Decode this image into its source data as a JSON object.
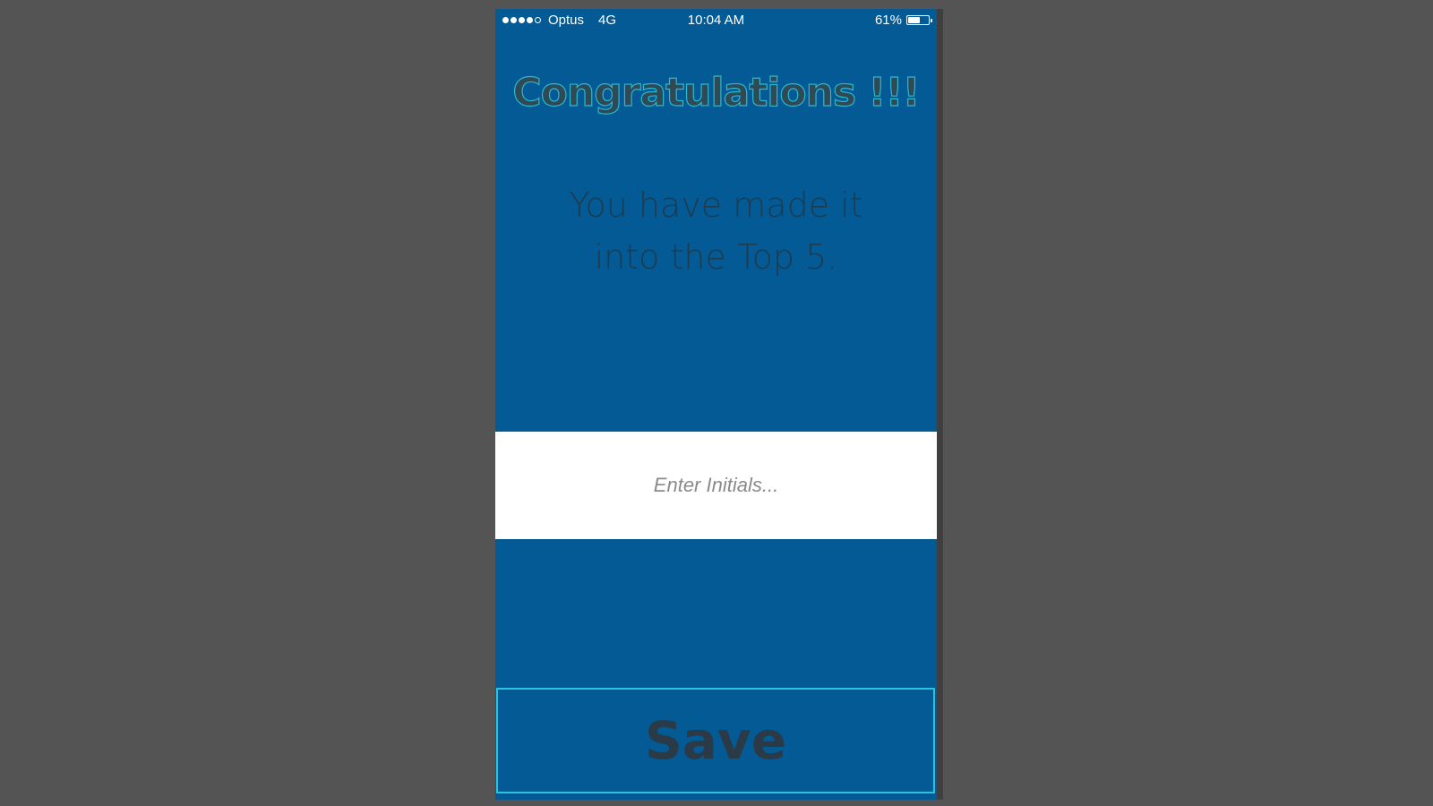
{
  "status_bar": {
    "signal_dots_filled": 4,
    "signal_dots_total": 5,
    "carrier": "Optus",
    "network": "4G",
    "time": "10:04 AM",
    "battery_percent": "61%",
    "battery_level": 0.61
  },
  "congrats": {
    "title": "Congratulations !!!",
    "message_line1": "You have made it",
    "message_line2": "into the Top 5."
  },
  "initials_field": {
    "value": "",
    "placeholder": "Enter Initials..."
  },
  "save_button": {
    "label": "Save"
  },
  "colors": {
    "screen_background": "#035a94",
    "page_background": "#545454",
    "button_border": "#27c3e0",
    "title_outline": "#2eb7cf"
  }
}
